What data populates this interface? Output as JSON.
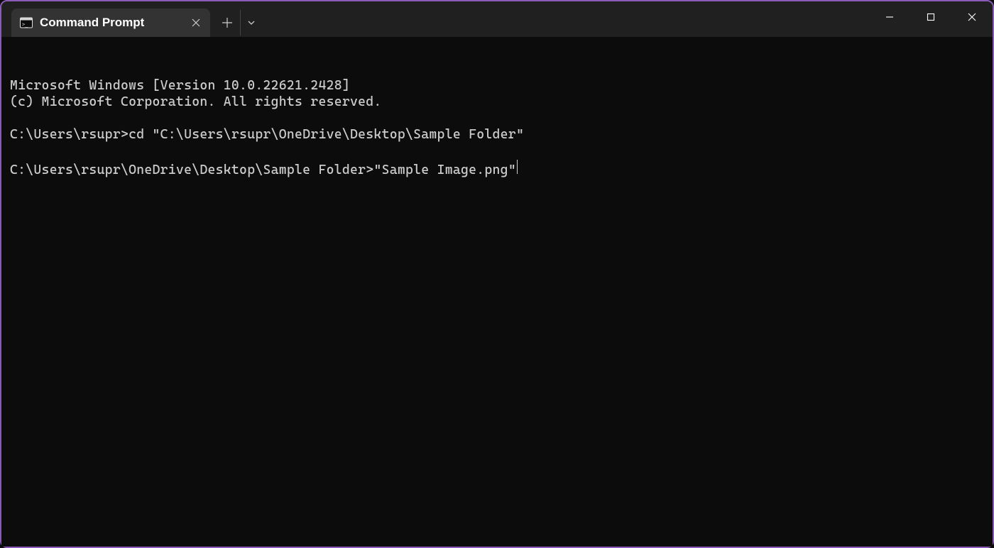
{
  "titlebar": {
    "tab": {
      "title": "Command Prompt"
    }
  },
  "terminal": {
    "lines": [
      "Microsoft Windows [Version 10.0.22621.2428]",
      "(c) Microsoft Corporation. All rights reserved.",
      "",
      "C:\\Users\\rsupr>cd \"C:\\Users\\rsupr\\OneDrive\\Desktop\\Sample Folder\"",
      ""
    ],
    "current_prompt": "C:\\Users\\rsupr\\OneDrive\\Desktop\\Sample Folder>",
    "current_input": "\"Sample Image.png\""
  }
}
